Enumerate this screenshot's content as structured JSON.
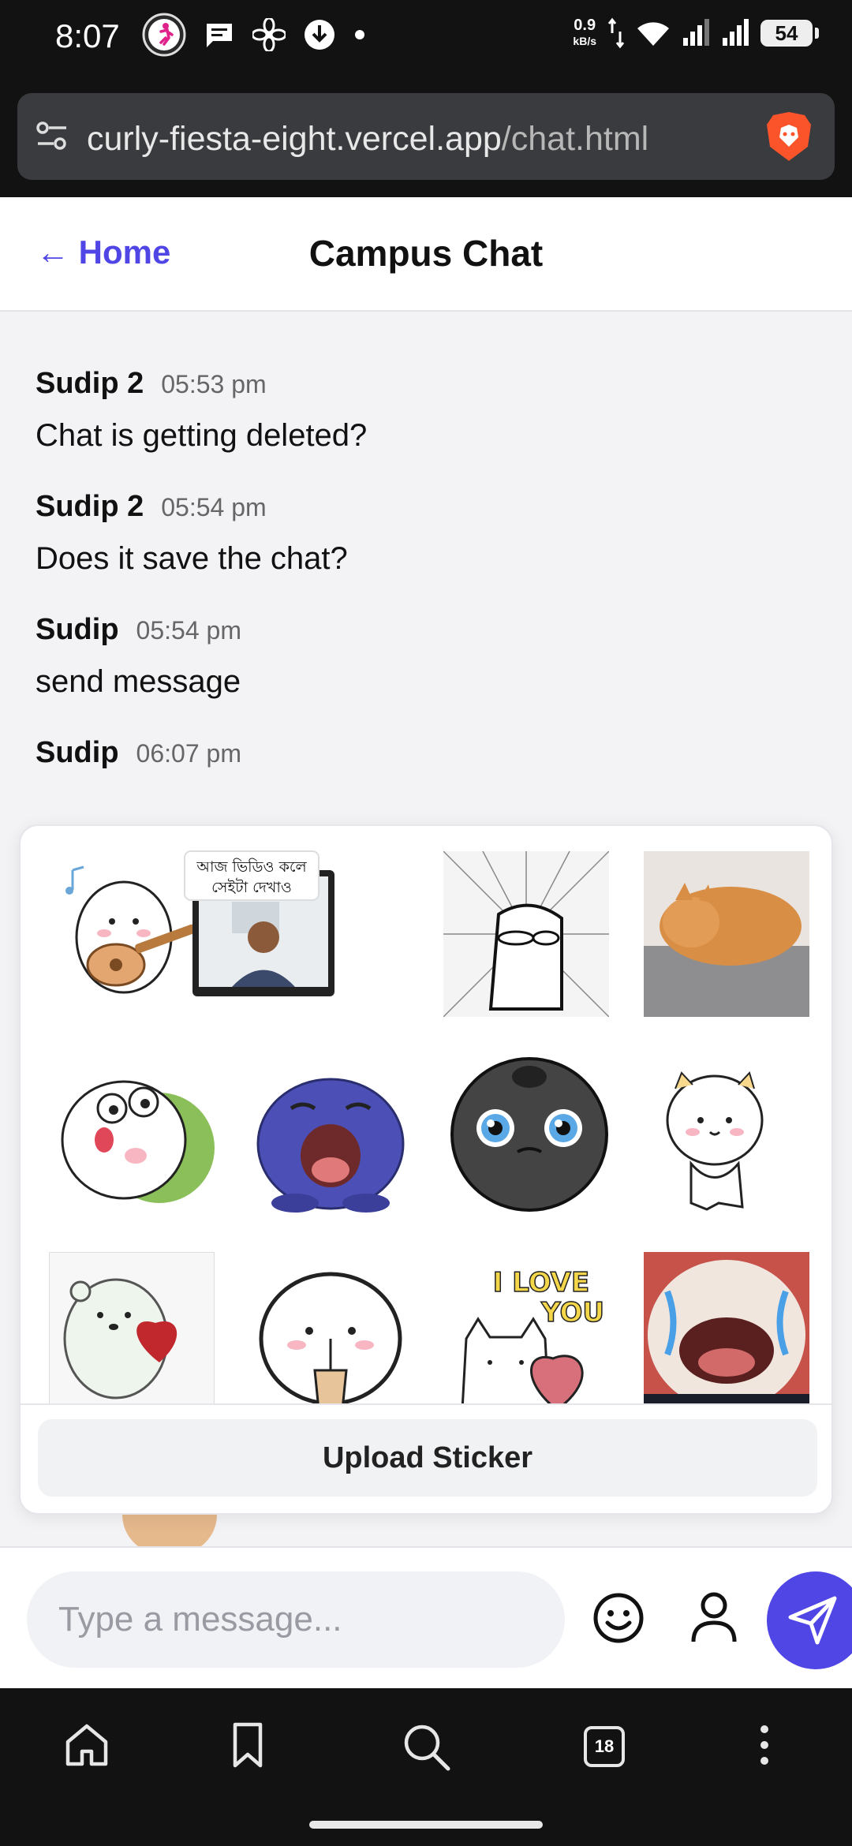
{
  "status_bar": {
    "time": "8:07",
    "net_speed_value": "0.9",
    "net_speed_unit": "kB/s",
    "battery": "54"
  },
  "browser": {
    "url_domain": "curly-fiesta-eight.vercel.app",
    "url_path": "/chat.html",
    "tab_count": "18"
  },
  "header": {
    "back_label": "← Home",
    "title": "Campus Chat"
  },
  "messages": [
    {
      "user": "Sudip 2",
      "time": "05:53 pm",
      "text": "Chat is getting deleted?"
    },
    {
      "user": "Sudip 2",
      "time": "05:54 pm",
      "text": "Does it save the chat?"
    },
    {
      "user": "Sudip",
      "time": "05:54 pm",
      "text": "send message"
    },
    {
      "user": "Sudip",
      "time": "06:07 pm",
      "text": ""
    }
  ],
  "sticker_panel": {
    "upload_label": "Upload Sticker",
    "sticker_2_caption_line1": "আজ ভিডিও কলে",
    "sticker_2_caption_line2": "সেইটা দেখাও",
    "sticker_11_text_1": "I LOVE",
    "sticker_11_text_2": "YOU"
  },
  "composer": {
    "placeholder": "Type a message...",
    "value": ""
  },
  "colors": {
    "accent": "#4f46e5",
    "background": "#f3f3f6"
  }
}
